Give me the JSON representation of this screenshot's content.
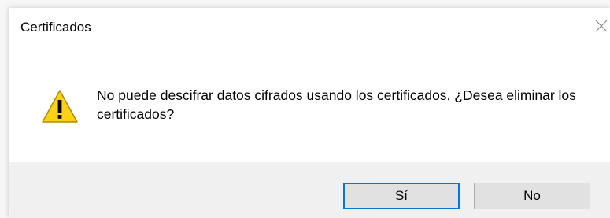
{
  "dialog": {
    "title": "Certificados",
    "close_icon": "close-icon",
    "icon": "warning-icon",
    "message": "No puede descifrar datos cifrados usando los certificados. ¿Desea eliminar los certificados?",
    "buttons": {
      "yes_label": "Sí",
      "no_label": "No"
    }
  },
  "colors": {
    "dialog_bg": "#ffffff",
    "footer_bg": "#f0f0f0",
    "default_button_border": "#0078d7",
    "button_bg": "#e1e1e1",
    "warning_fill": "#fcd116"
  }
}
